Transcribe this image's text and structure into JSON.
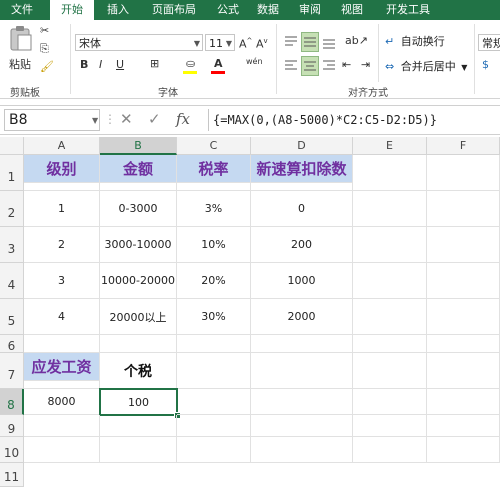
{
  "ribbon_tabs": [
    "文件",
    "开始",
    "插入",
    "页面布局",
    "公式",
    "数据",
    "审阅",
    "视图",
    "开发工具"
  ],
  "active_tab": "开始",
  "clipboard": {
    "paste_label": "粘贴",
    "group_label": "剪贴板"
  },
  "font": {
    "name": "宋体",
    "size": "11",
    "group_label": "字体",
    "bold": "B",
    "italic": "I",
    "underline": "U",
    "font_color_letter": "A",
    "wen": "wén"
  },
  "alignment": {
    "wrap_label": "自动换行",
    "merge_label": "合并后居中",
    "group_label": "对齐方式"
  },
  "number": {
    "format": "常规"
  },
  "formula_bar": {
    "name_box": "B8",
    "formula": "{=MAX(0,(A8-5000)*C2:C5-D2:D5)}",
    "fx": "fx"
  },
  "columns": [
    "A",
    "B",
    "C",
    "D",
    "E",
    "F"
  ],
  "selected_column": "B",
  "rows": [
    "1",
    "2",
    "3",
    "4",
    "5",
    "6",
    "7",
    "8",
    "9",
    "10",
    "11"
  ],
  "selected_row": "8",
  "table": {
    "headers": [
      "级别",
      "金额",
      "税率",
      "新速算扣除数"
    ],
    "data": [
      [
        "1",
        "0-3000",
        "3%",
        "0"
      ],
      [
        "2",
        "3000-10000",
        "10%",
        "200"
      ],
      [
        "3",
        "10000-20000",
        "20%",
        "1000"
      ],
      [
        "4",
        "20000以上",
        "30%",
        "2000"
      ]
    ]
  },
  "salary": {
    "label": "应发工资",
    "tax_label": "个税",
    "value": "8000",
    "tax_value": "100"
  },
  "colors": {
    "accent": "#217346",
    "header_fill": "#c5d9f1",
    "header_text": "#7030a0"
  }
}
